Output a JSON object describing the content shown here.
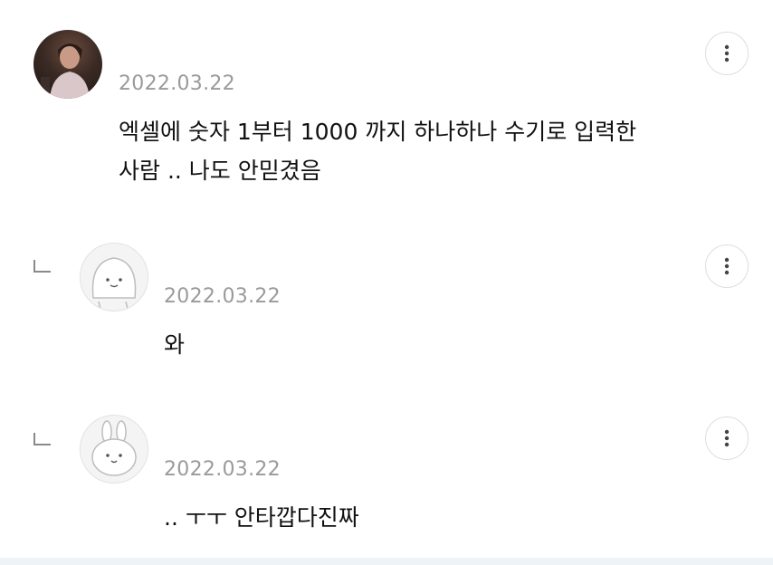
{
  "comments": [
    {
      "author_avatar": "person-photo",
      "date": "2022.03.22",
      "text_lines": [
        "엑셀에 숫자 1부터 1000 까지 하나하나 수기로 입력한",
        "사람 .. 나도 안믿겼음"
      ]
    },
    {
      "author_avatar": "blob-face",
      "date": "2022.03.22",
      "text": "와",
      "is_reply": true
    },
    {
      "author_avatar": "bunny-face",
      "date": "2022.03.22",
      "text": ".. ㅜㅜ 안타깝다진짜",
      "is_reply": true
    }
  ],
  "icons": {
    "more": "more-vertical-icon",
    "reply": "reply-arrow-icon"
  },
  "colors": {
    "date": "#9a9a9a",
    "text": "#111111",
    "border": "#dedede"
  }
}
